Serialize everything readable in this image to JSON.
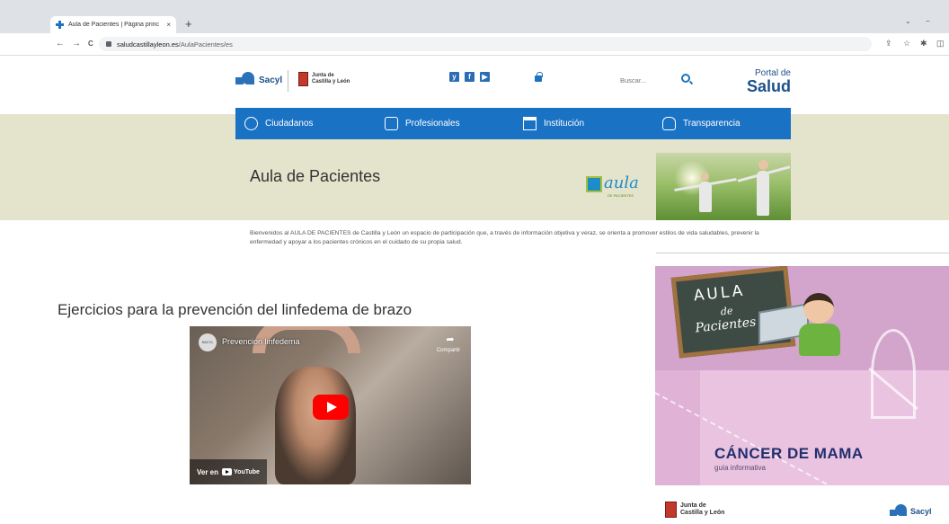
{
  "browser": {
    "tab_title": "Aula de Pacientes | Página princ",
    "tab_close": "×",
    "new_tab": "+",
    "url_host": "saludcastillayleon.es",
    "url_path": "/AulaPacientes/es",
    "nav_back": "←",
    "nav_forward": "→",
    "nav_reload": "C",
    "win_minimize": "−",
    "win_chevron": "⌄",
    "tool_share": "⇪",
    "tool_star": "☆",
    "tool_ext": "✱",
    "tool_side": "◫"
  },
  "header": {
    "sacyl_label": "Sacyl",
    "jcyl_line1": "Junta de",
    "jcyl_line2": "Castilla y León",
    "social": [
      "y",
      "f",
      "▶"
    ],
    "search_placeholder": "Buscar...",
    "portal_line1": "Portal de",
    "portal_line2": "Salud"
  },
  "nav": {
    "items": [
      {
        "label": "Ciudadanos",
        "icon": "users-icon"
      },
      {
        "label": "Profesionales",
        "icon": "professionals-icon"
      },
      {
        "label": "Institución",
        "icon": "building-icon"
      },
      {
        "label": "Transparencia",
        "icon": "hand-icon"
      }
    ]
  },
  "banner": {
    "title": "Aula de Pacientes",
    "logo_text": "ula",
    "logo_letter": "a",
    "logo_sub": "DE PACIENTES"
  },
  "intro": {
    "text": "Bienvenidos al AULA DE PACIENTES de Castilla y León un espacio de participación que, a través de información objetiva y veraz, se orienta a promover estilos de vida saludables, prevenir la enfermedad y apoyar a los pacientes crónicos en el cuidado de su propia salud."
  },
  "video_section": {
    "title": "Ejercicios para la prevención del linfedema de brazo",
    "video_title": "Prevencion linfedema",
    "channel_avatar": "SACYL",
    "share_label": "Compartir",
    "watch_on": "Ver en",
    "youtube": "YouTube"
  },
  "promo": {
    "board_aula": "AULA",
    "board_de": "de",
    "board_pacientes": "Pacientes",
    "headline": "CÁNCER DE MAMA",
    "subline": "guía informativa"
  },
  "footer": {
    "jcyl_line1": "Junta de",
    "jcyl_line2": "Castilla y León",
    "sacyl_label": "Sacyl"
  }
}
